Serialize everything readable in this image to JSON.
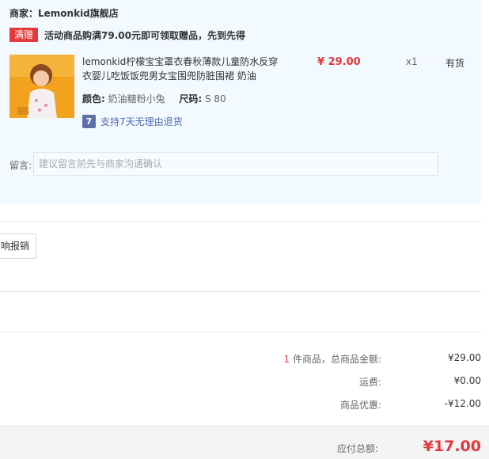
{
  "shop": {
    "label": "商家：",
    "name": "Lemonkid旗舰店"
  },
  "promo": {
    "badge": "满赠",
    "text": "活动商品购满79.00元即可领取赠品，先到先得"
  },
  "product": {
    "title": "lemonkid柠檬宝宝罩衣春秋薄款儿童防水反穿衣婴儿吃饭饭兜男女宝围兜防脏围裙 奶油",
    "color_label": "颜色:",
    "color_value": "奶油糖粉小兔",
    "size_label": "尺码:",
    "size_value": "S 80",
    "return_icon": "7",
    "return_text": "支持7天无理由退货",
    "price": "¥ 29.00",
    "qty": "x1",
    "stock": "有货"
  },
  "memo": {
    "label": "留言:",
    "placeholder": "建议留言前先与商家沟通确认"
  },
  "reimburse": {
    "label": "响报销"
  },
  "summary": {
    "count": "1",
    "goods_label": "件商品，总商品金额:",
    "goods_value": "¥29.00",
    "shipping_label": "运费:",
    "shipping_value": "¥0.00",
    "discount_label": "商品优惠:",
    "discount_value": "-¥12.00"
  },
  "total": {
    "label": "应付总额:",
    "value": "¥17.00"
  },
  "colors": {
    "accent": "#e4393c",
    "panel": "#f2f9ff",
    "link": "#4f6db0"
  }
}
